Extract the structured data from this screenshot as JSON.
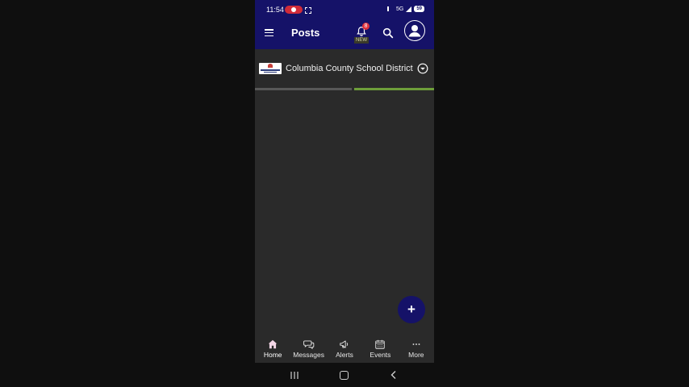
{
  "status_bar": {
    "time": "11:54",
    "network": "5G",
    "battery": "59"
  },
  "app_bar": {
    "title": "Posts",
    "notification_count": "8",
    "new_label": "NEW"
  },
  "district": {
    "name": "Columbia County School District"
  },
  "fab": {
    "label": "+"
  },
  "bottom_nav": {
    "items": [
      {
        "label": "Home",
        "icon": "home-icon",
        "active": true
      },
      {
        "label": "Messages",
        "icon": "messages-icon",
        "active": false
      },
      {
        "label": "Alerts",
        "icon": "megaphone-icon",
        "active": false
      },
      {
        "label": "Events",
        "icon": "calendar-icon",
        "active": false
      },
      {
        "label": "More",
        "icon": "more-icon",
        "active": false
      }
    ]
  },
  "colors": {
    "primary": "#151268",
    "surface": "#2a2a2a",
    "tab_active": "#6e9e3a",
    "badge": "#e0313c"
  }
}
